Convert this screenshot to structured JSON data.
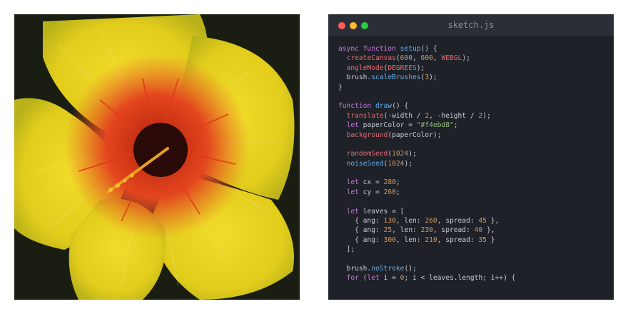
{
  "editor": {
    "filename": "sketch.js",
    "window_controls": [
      "close",
      "minimize",
      "maximize"
    ],
    "colors": {
      "background": "#1e2127",
      "titlebar": "#2a2e36",
      "keyword": "#c678dd",
      "function": "#61afef",
      "call": "#e06c75",
      "number": "#d19a66",
      "string": "#98c379",
      "plain": "#c8ccd4"
    },
    "code_lines": [
      [
        {
          "t": "kw",
          "s": "async function "
        },
        {
          "t": "fn",
          "s": "setup"
        },
        {
          "t": "plain",
          "s": "() {"
        }
      ],
      [
        {
          "t": "plain",
          "s": "  "
        },
        {
          "t": "call",
          "s": "createCanvas"
        },
        {
          "t": "plain",
          "s": "("
        },
        {
          "t": "num",
          "s": "600"
        },
        {
          "t": "plain",
          "s": ", "
        },
        {
          "t": "num",
          "s": "600"
        },
        {
          "t": "plain",
          "s": ", "
        },
        {
          "t": "call",
          "s": "WEBGL"
        },
        {
          "t": "plain",
          "s": ");"
        }
      ],
      [
        {
          "t": "plain",
          "s": "  "
        },
        {
          "t": "call",
          "s": "angleMode"
        },
        {
          "t": "plain",
          "s": "("
        },
        {
          "t": "call",
          "s": "DEGREES"
        },
        {
          "t": "plain",
          "s": ");"
        }
      ],
      [
        {
          "t": "plain",
          "s": "  brush."
        },
        {
          "t": "fn",
          "s": "scaleBrushes"
        },
        {
          "t": "plain",
          "s": "("
        },
        {
          "t": "num",
          "s": "3"
        },
        {
          "t": "plain",
          "s": ");"
        }
      ],
      [
        {
          "t": "plain",
          "s": "}"
        }
      ],
      [],
      [
        {
          "t": "kw",
          "s": "function "
        },
        {
          "t": "fn",
          "s": "draw"
        },
        {
          "t": "plain",
          "s": "() {"
        }
      ],
      [
        {
          "t": "plain",
          "s": "  "
        },
        {
          "t": "call",
          "s": "translate"
        },
        {
          "t": "plain",
          "s": "(-width / "
        },
        {
          "t": "num",
          "s": "2"
        },
        {
          "t": "plain",
          "s": ", -height / "
        },
        {
          "t": "num",
          "s": "2"
        },
        {
          "t": "plain",
          "s": ");"
        }
      ],
      [
        {
          "t": "plain",
          "s": "  "
        },
        {
          "t": "kw",
          "s": "let "
        },
        {
          "t": "plain",
          "s": "paperColor = "
        },
        {
          "t": "str",
          "s": "\"#f4ebd8\""
        },
        {
          "t": "plain",
          "s": ";"
        }
      ],
      [
        {
          "t": "plain",
          "s": "  "
        },
        {
          "t": "call",
          "s": "background"
        },
        {
          "t": "plain",
          "s": "(paperColor);"
        }
      ],
      [],
      [
        {
          "t": "plain",
          "s": "  "
        },
        {
          "t": "call",
          "s": "randomSeed"
        },
        {
          "t": "plain",
          "s": "("
        },
        {
          "t": "num",
          "s": "1024"
        },
        {
          "t": "plain",
          "s": ");"
        }
      ],
      [
        {
          "t": "plain",
          "s": "  "
        },
        {
          "t": "fn",
          "s": "noiseSeed"
        },
        {
          "t": "plain",
          "s": "("
        },
        {
          "t": "num",
          "s": "1024"
        },
        {
          "t": "plain",
          "s": ");"
        }
      ],
      [],
      [
        {
          "t": "plain",
          "s": "  "
        },
        {
          "t": "kw",
          "s": "let "
        },
        {
          "t": "plain",
          "s": "cx = "
        },
        {
          "t": "num",
          "s": "280"
        },
        {
          "t": "plain",
          "s": ";"
        }
      ],
      [
        {
          "t": "plain",
          "s": "  "
        },
        {
          "t": "kw",
          "s": "let "
        },
        {
          "t": "plain",
          "s": "cy = "
        },
        {
          "t": "num",
          "s": "260"
        },
        {
          "t": "plain",
          "s": ";"
        }
      ],
      [],
      [
        {
          "t": "plain",
          "s": "  "
        },
        {
          "t": "kw",
          "s": "let "
        },
        {
          "t": "plain",
          "s": "leaves = ["
        }
      ],
      [
        {
          "t": "plain",
          "s": "    { ang: "
        },
        {
          "t": "num",
          "s": "130"
        },
        {
          "t": "plain",
          "s": ", len: "
        },
        {
          "t": "num",
          "s": "260"
        },
        {
          "t": "plain",
          "s": ", spread: "
        },
        {
          "t": "num",
          "s": "45"
        },
        {
          "t": "plain",
          "s": " },"
        }
      ],
      [
        {
          "t": "plain",
          "s": "    { ang: "
        },
        {
          "t": "num",
          "s": "25"
        },
        {
          "t": "plain",
          "s": ", len: "
        },
        {
          "t": "num",
          "s": "230"
        },
        {
          "t": "plain",
          "s": ", spread: "
        },
        {
          "t": "num",
          "s": "40"
        },
        {
          "t": "plain",
          "s": " },"
        }
      ],
      [
        {
          "t": "plain",
          "s": "    { ang: "
        },
        {
          "t": "num",
          "s": "300"
        },
        {
          "t": "plain",
          "s": ", len: "
        },
        {
          "t": "num",
          "s": "210"
        },
        {
          "t": "plain",
          "s": ", spread: "
        },
        {
          "t": "num",
          "s": "35"
        },
        {
          "t": "plain",
          "s": " }"
        }
      ],
      [
        {
          "t": "plain",
          "s": "  ];"
        }
      ],
      [],
      [
        {
          "t": "plain",
          "s": "  brush."
        },
        {
          "t": "fn",
          "s": "noStroke"
        },
        {
          "t": "plain",
          "s": "();"
        }
      ],
      [
        {
          "t": "plain",
          "s": "  "
        },
        {
          "t": "kw",
          "s": "for "
        },
        {
          "t": "plain",
          "s": "("
        },
        {
          "t": "kw",
          "s": "let "
        },
        {
          "t": "plain",
          "s": "i = "
        },
        {
          "t": "num",
          "s": "0"
        },
        {
          "t": "plain",
          "s": "; i < leaves.length; i++) {"
        }
      ]
    ]
  },
  "artwork": {
    "subject": "hibiscus-flower-painting",
    "colors": {
      "background": "#1a1e12",
      "petal": "#e8d21e",
      "petal_shade": "#c9b814",
      "center": "#e0441e",
      "core": "#2a0a08",
      "stamen": "#e8a020"
    }
  }
}
